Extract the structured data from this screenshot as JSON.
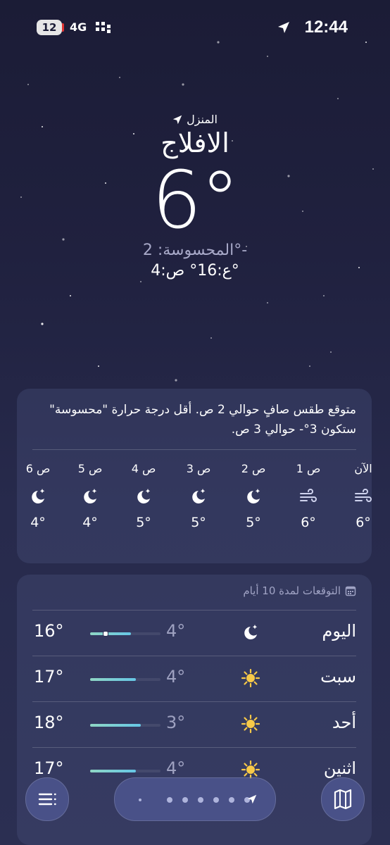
{
  "status_bar": {
    "battery": "12",
    "network": "4G",
    "time": "12:44"
  },
  "location": {
    "home_label": "المنزل",
    "city": "الافلاج",
    "temperature": "6°",
    "feels_like": "المحسوسة: 2°-",
    "high_low": "ع:16° ص:4°"
  },
  "hourly": {
    "summary": "متوقع طقس صافٍ حوالي 2 ص. أقل درجة حرارة \"محسوسة\" ستكون 3°- حوالي 3 ص.",
    "items": [
      {
        "label": "الآن",
        "icon": "wind-icon",
        "temp": "6°"
      },
      {
        "label": "1 ص",
        "icon": "wind-icon",
        "temp": "6°"
      },
      {
        "label": "2 ص",
        "icon": "moon-stars-icon",
        "temp": "5°"
      },
      {
        "label": "3 ص",
        "icon": "moon-stars-icon",
        "temp": "5°"
      },
      {
        "label": "4 ص",
        "icon": "moon-stars-icon",
        "temp": "5°"
      },
      {
        "label": "5 ص",
        "icon": "moon-stars-icon",
        "temp": "4°"
      },
      {
        "label": "6 ص",
        "icon": "moon-stars-icon",
        "temp": "4°"
      }
    ]
  },
  "forecast": {
    "title": "التوقعات لمدة 10 أيام",
    "days": [
      {
        "day": "اليوم",
        "icon": "moon-stars-icon",
        "low": "4°",
        "high": "16°",
        "bar_from": 0.42,
        "bar_to": 1.0,
        "now_marker": 0.2
      },
      {
        "day": "سبت",
        "icon": "sun-icon",
        "low": "4°",
        "high": "17°",
        "bar_from": 0.35,
        "bar_to": 1.0
      },
      {
        "day": "أحد",
        "icon": "sun-icon",
        "low": "3°",
        "high": "18°",
        "bar_from": 0.28,
        "bar_to": 1.0
      },
      {
        "day": "اثنين",
        "icon": "sun-icon",
        "low": "4°",
        "high": "17°",
        "bar_from": 0.35,
        "bar_to": 1.0
      }
    ]
  },
  "bottom_bar": {
    "page_dots": 7,
    "active_page": "location"
  },
  "colors": {
    "background_top": "#1b1c36",
    "background_bottom": "#2b2f52",
    "sun": "#f7c948",
    "bar_start": "#8fd6c4",
    "bar_end": "#66c7e6"
  }
}
